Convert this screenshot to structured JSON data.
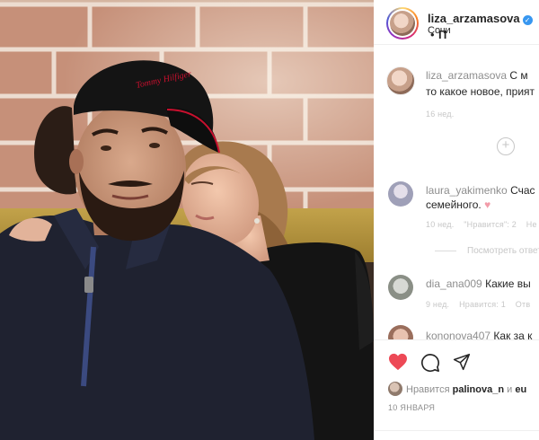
{
  "header": {
    "username": "liza_arzamasova",
    "verified_icon": "✓",
    "dot": "•",
    "follow": "П",
    "location": "Сочи"
  },
  "caption": {
    "username": "liza_arzamasova",
    "text_1": "С м",
    "text_2": "то какое новое, прият",
    "time": "16 нед."
  },
  "comments": [
    {
      "username": "laura_yakimenko",
      "text_1": "Счас",
      "text_2": "семейного.",
      "emoji": "♥",
      "time": "10 нед.",
      "likes": "\"Нравится\": 2",
      "reply": "Не",
      "view_replies": "Посмотреть ответ"
    },
    {
      "username": "dia_ana009",
      "text": "Какие вы",
      "time": "9 нед.",
      "likes": "Нравится: 1",
      "reply": "Отв"
    },
    {
      "username": "kononova407",
      "text": "Как за к"
    }
  ],
  "actions": {
    "likes_prefix": "Нравится",
    "likes_user": "palinova_n",
    "likes_and": "и",
    "likes_tail": "eu",
    "date": "10 ЯНВАРЯ"
  },
  "colors": {
    "accent_blue": "#3897f0",
    "muted": "#8e8e8e",
    "like_red": "#ed4956",
    "cap_red": "#c8102e"
  }
}
